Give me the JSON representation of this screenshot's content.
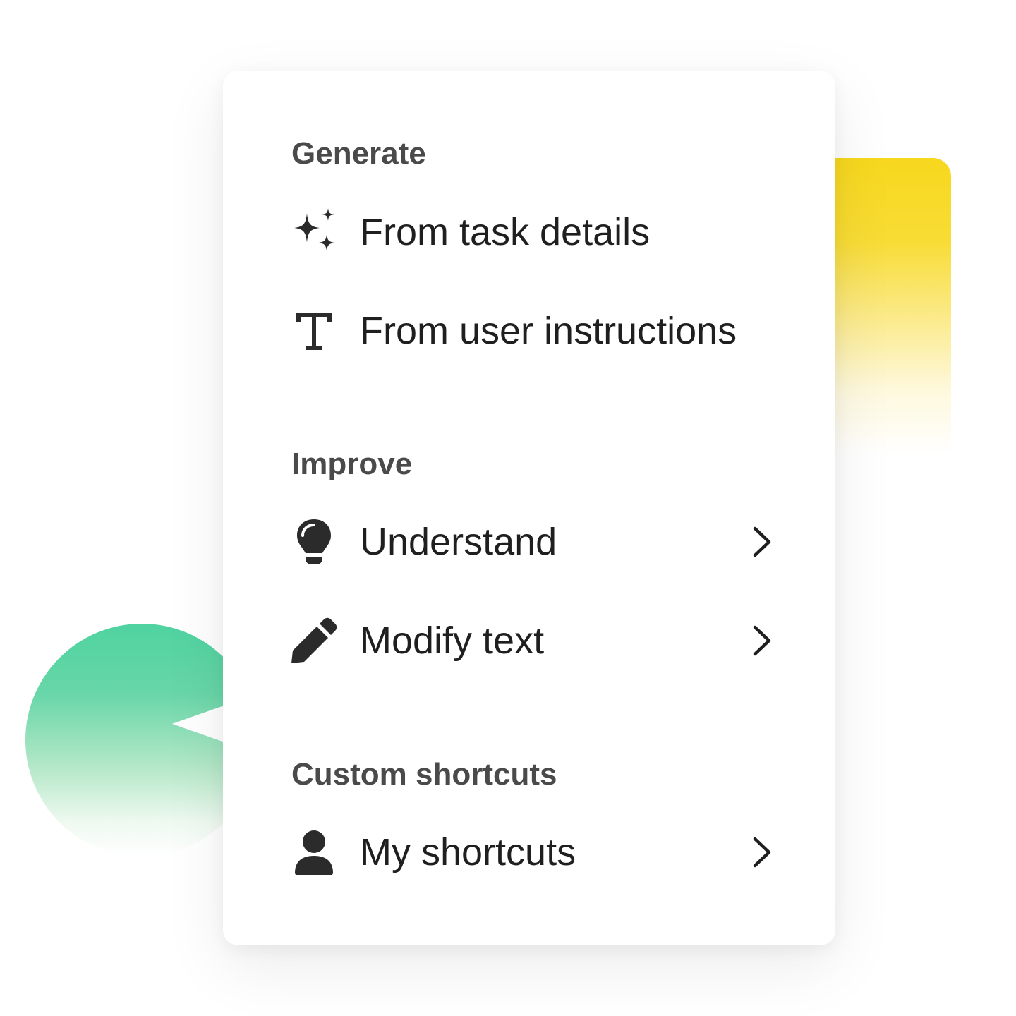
{
  "menu": {
    "sections": [
      {
        "title": "Generate",
        "items": [
          {
            "label": "From task details",
            "icon": "sparkles-icon",
            "has_submenu": false
          },
          {
            "label": "From user instructions",
            "icon": "text-type-icon",
            "has_submenu": false
          }
        ]
      },
      {
        "title": "Improve",
        "items": [
          {
            "label": "Understand",
            "icon": "lightbulb-icon",
            "has_submenu": true
          },
          {
            "label": "Modify text",
            "icon": "pencil-icon",
            "has_submenu": true
          }
        ]
      },
      {
        "title": "Custom shortcuts",
        "items": [
          {
            "label": "My shortcuts",
            "icon": "user-icon",
            "has_submenu": true
          }
        ]
      }
    ]
  },
  "colors": {
    "section_title": "#4a4a4a",
    "item_text": "#1f1f1f",
    "icon": "#2b2b2b",
    "accent_yellow": "#f7d81e",
    "accent_green": "#4fd3a0"
  }
}
